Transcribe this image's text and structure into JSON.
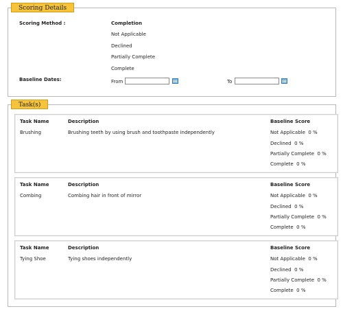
{
  "scoring": {
    "legend": "Scoring Details",
    "method_label": "Scoring Method :",
    "completion_header": "Completion",
    "options": [
      "Not Applicable",
      "Declined",
      "Partially Complete",
      "Complete"
    ],
    "baseline_label": "Baseline Dates:",
    "from_label": "From",
    "to_label": "To"
  },
  "tasks": {
    "legend": "Task(s)",
    "headers": {
      "name": "Task Name",
      "desc": "Description",
      "score": "Baseline Score"
    },
    "items": [
      {
        "name": "Brushing",
        "desc": "Brushing teeth by using brush and toothpaste independently",
        "scores": [
          "Not Applicable  0 %",
          "Declined  0 %",
          "Partially Complete  0 %",
          "Complete  0 %"
        ]
      },
      {
        "name": "Combing",
        "desc": "Combing hair in front of mirror",
        "scores": [
          "Not Applicable  0 %",
          "Declined  0 %",
          "Partially Complete  0 %",
          "Complete  0 %"
        ]
      },
      {
        "name": "Tying Shoe",
        "desc": "Tying shoes independently",
        "scores": [
          "Not Applicable  0 %",
          "Declined  0 %",
          "Partially Complete  0 %",
          "Complete  0 %"
        ]
      }
    ]
  }
}
